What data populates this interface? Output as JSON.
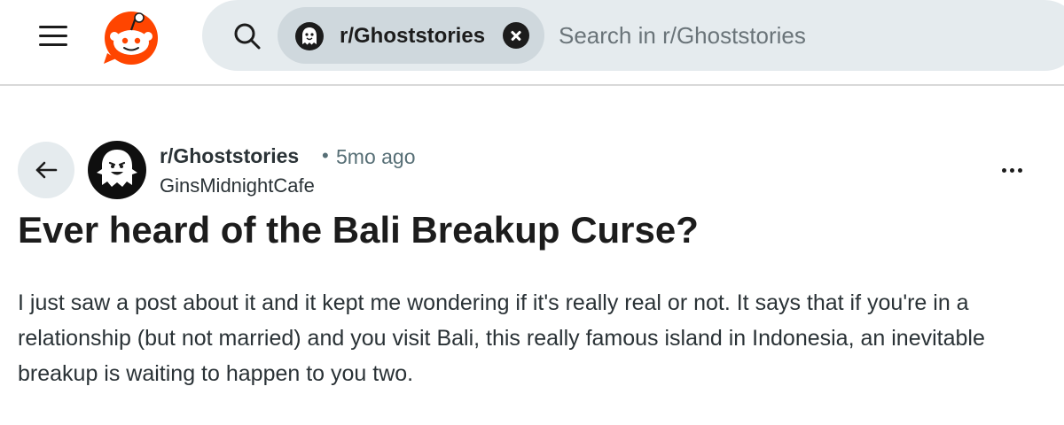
{
  "header": {
    "menu_icon": "hamburger-icon",
    "logo_icon": "reddit-logo",
    "search": {
      "icon": "search-icon",
      "community_chip": {
        "label": "r/Ghoststories",
        "avatar_icon": "ghost-icon",
        "close_icon": "close-icon"
      },
      "placeholder": "Search in r/Ghoststories",
      "value": ""
    }
  },
  "post": {
    "back_icon": "arrow-left-icon",
    "subreddit": "r/Ghoststories",
    "separator": "•",
    "time_ago": "5mo ago",
    "author": "GinsMidnightCafe",
    "more_icon": "more-horizontal-icon",
    "title": "Ever heard of the Bali Breakup Curse?",
    "body": "I just saw a post about it and it kept me wondering if it's really real or not. It says that if you're in a relationship (but not married) and you visit Bali, this really famous island in Indonesia, an inevitable breakup is waiting to happen to you two."
  },
  "colors": {
    "brand": "#ff4500",
    "search_bg": "#e5ebee",
    "chip_bg": "#cfd8dd",
    "meta_text": "#576f76"
  }
}
